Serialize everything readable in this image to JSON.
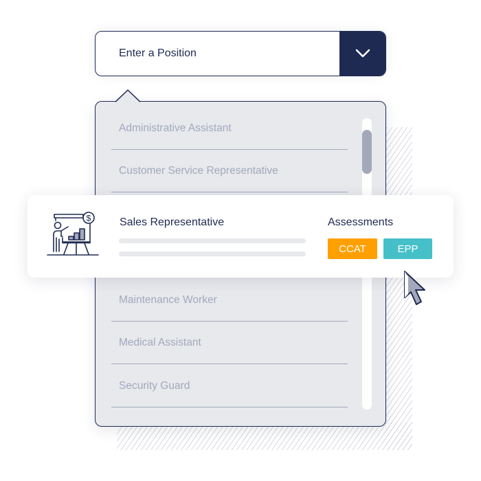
{
  "search": {
    "placeholder": "Enter a Position",
    "value": "",
    "dropdown_icon": "chevron-down-icon"
  },
  "dropdown": {
    "items": [
      {
        "label": "Administrative Assistant"
      },
      {
        "label": "Customer Service Representative"
      },
      {
        "label": "Maintenance Worker"
      },
      {
        "label": "Medical Assistant"
      },
      {
        "label": "Security Guard"
      }
    ],
    "scroll_position_fraction": 0.05
  },
  "highlighted": {
    "title": "Sales Representative",
    "icon": "presentation-sales-chart-icon",
    "assessments_label": "Assessments",
    "badges": [
      {
        "label": "CCAT",
        "color": "#ffa000"
      },
      {
        "label": "EPP",
        "color": "#45c0c8"
      }
    ]
  },
  "colors": {
    "navy": "#1e2a52",
    "muted_text": "#a2a8bd",
    "panel_bg": "#e8e9ec"
  },
  "cursor": {
    "icon": "mouse-pointer-icon"
  }
}
